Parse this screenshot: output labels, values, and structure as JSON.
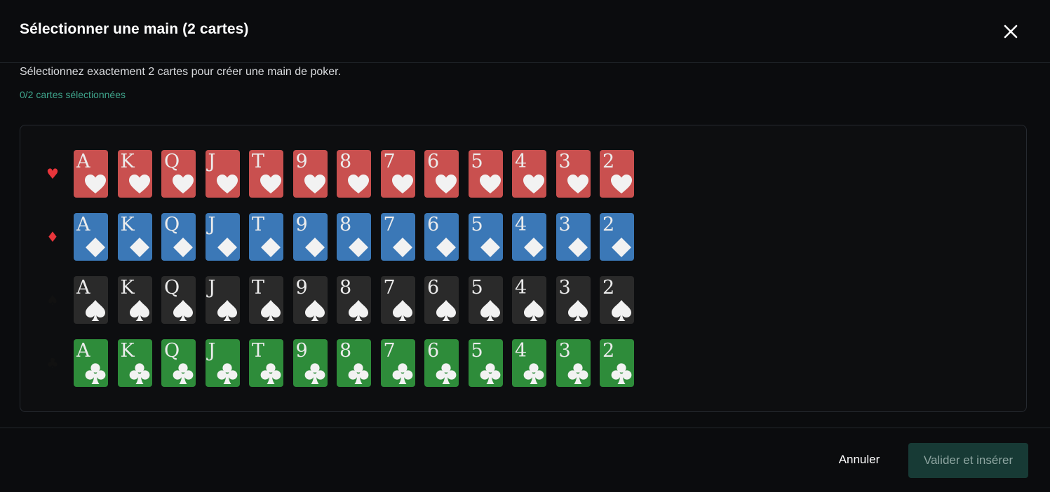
{
  "dialog": {
    "title": "Sélectionner une main (2 cartes)",
    "close_icon": "close-icon",
    "instructions": "Sélectionnez exactement 2 cartes pour créer une main de poker.",
    "counter": "0/2 cartes sélectionnées"
  },
  "ranks": [
    "A",
    "K",
    "Q",
    "J",
    "T",
    "9",
    "8",
    "7",
    "6",
    "5",
    "4",
    "3",
    "2"
  ],
  "suits": [
    {
      "key": "hearts",
      "symbol": "♥",
      "symbol_color": "#e8353b",
      "card_color": "#c9504f",
      "icon": "heart-icon"
    },
    {
      "key": "diamonds",
      "symbol": "♦",
      "symbol_color": "#e8353b",
      "card_color": "#3b78b7",
      "icon": "diamond-icon"
    },
    {
      "key": "spades",
      "symbol": "♠",
      "symbol_color": "#111111",
      "card_color": "#2a2a2a",
      "icon": "spade-icon"
    },
    {
      "key": "clubs",
      "symbol": "♣",
      "symbol_color": "#111111",
      "card_color": "#2e8c3a",
      "icon": "club-icon"
    }
  ],
  "footer": {
    "cancel_label": "Annuler",
    "confirm_label": "Valider et insérer"
  },
  "colors": {
    "background": "#0b0c0e",
    "accent": "#3fa58c",
    "confirm_bg": "#173a35"
  }
}
